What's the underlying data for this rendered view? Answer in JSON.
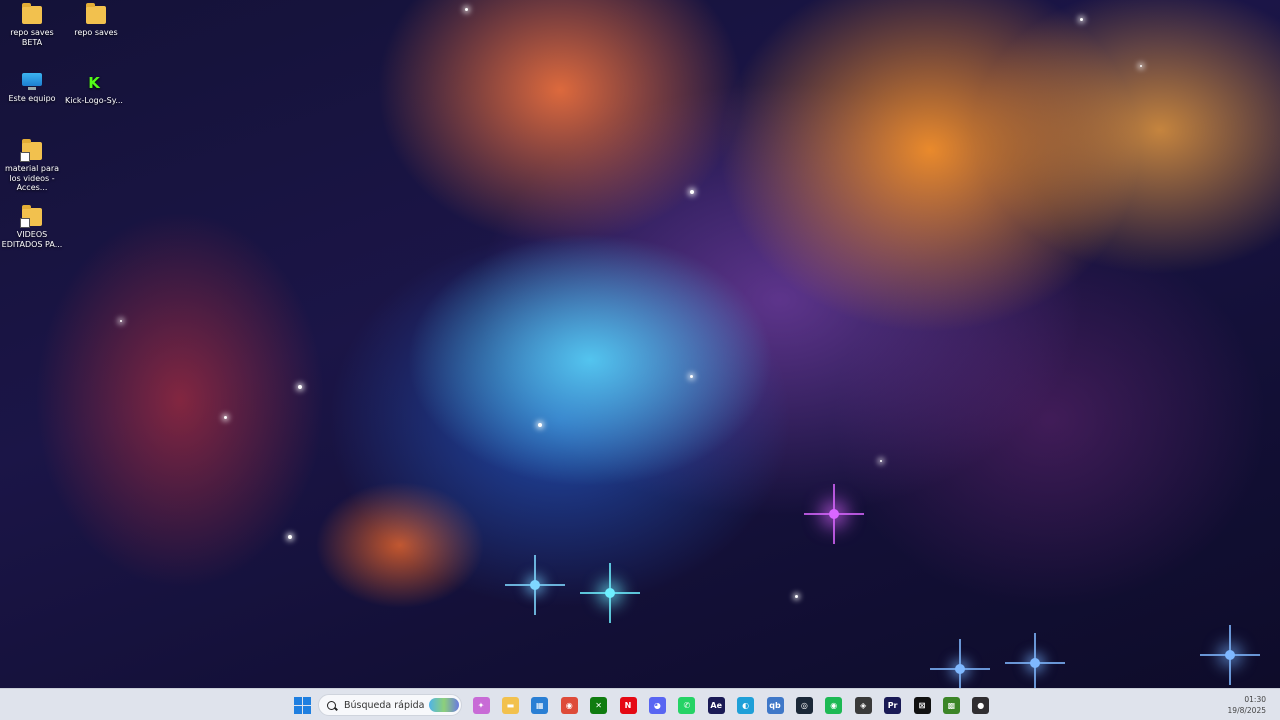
{
  "desktop": {
    "icons": [
      {
        "label": "repo saves BETA",
        "icon": "folder-icon"
      },
      {
        "label": "repo saves",
        "icon": "folder-icon"
      },
      {
        "label": "Este equipo",
        "icon": "computer-icon"
      },
      {
        "label": "Kick-Logo-Sy...",
        "icon": "kick-logo-icon",
        "glyph": "K"
      },
      {
        "label": "material para los videos - Acces...",
        "icon": "folder-shortcut-icon"
      },
      {
        "label": "VIDEOS EDITADOS PA...",
        "icon": "folder-shortcut-icon"
      }
    ]
  },
  "taskbar": {
    "search_placeholder": "Búsqueda rápida",
    "apps": [
      {
        "name": "copilot",
        "glyph": "✦",
        "color": "#c86bd6"
      },
      {
        "name": "file-explorer",
        "glyph": "▬",
        "color": "#f2c14e"
      },
      {
        "name": "microsoft-store",
        "glyph": "▦",
        "color": "#2a7fd4"
      },
      {
        "name": "chrome",
        "glyph": "◉",
        "color": "#de4b39"
      },
      {
        "name": "xbox",
        "glyph": "✕",
        "color": "#107c10"
      },
      {
        "name": "netflix",
        "glyph": "N",
        "color": "#e50914"
      },
      {
        "name": "discord",
        "glyph": "◕",
        "color": "#5865f2"
      },
      {
        "name": "whatsapp",
        "glyph": "✆",
        "color": "#25d366"
      },
      {
        "name": "after-effects",
        "glyph": "Ae",
        "color": "#1a1a55"
      },
      {
        "name": "edge",
        "glyph": "◐",
        "color": "#1fa0d8"
      },
      {
        "name": "qbittorrent",
        "glyph": "qb",
        "color": "#3f78c8"
      },
      {
        "name": "steam",
        "glyph": "◎",
        "color": "#1b2838"
      },
      {
        "name": "spotify",
        "glyph": "◉",
        "color": "#1db954"
      },
      {
        "name": "android-app",
        "glyph": "◈",
        "color": "#3a3a3a"
      },
      {
        "name": "premiere-pro",
        "glyph": "Pr",
        "color": "#1a1a55"
      },
      {
        "name": "capcut",
        "glyph": "⊠",
        "color": "#111111"
      },
      {
        "name": "minecraft",
        "glyph": "▩",
        "color": "#3c8527"
      },
      {
        "name": "obs-studio",
        "glyph": "●",
        "color": "#302e31"
      }
    ],
    "clock": {
      "time": "01:30",
      "date": "19/8/2025"
    }
  }
}
